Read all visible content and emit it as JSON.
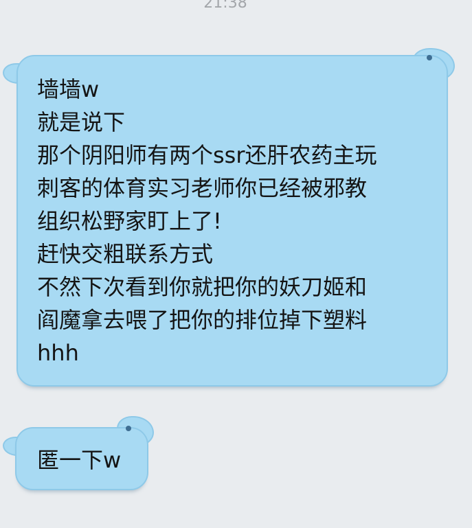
{
  "status": {
    "time": "21:38"
  },
  "messages": [
    {
      "lines": [
        "墙墙w",
        "就是说下",
        "那个阴阳师有两个ssr还肝农药主玩",
        "刺客的体育实习老师你已经被邪教",
        "组织松野家盯上了!",
        "赶快交粗联系方式",
        "不然下次看到你就把你的妖刀姬和",
        "阎魔拿去喂了把你的排位掉下塑料",
        "hhh"
      ]
    },
    {
      "lines": [
        "匿一下w"
      ]
    }
  ],
  "colors": {
    "background": "#e9ecef",
    "bubble_fill": "#a8daf3",
    "bubble_border": "#8ec9e8",
    "text": "#141414",
    "timestamp": "#a3a6aa"
  },
  "icons": {
    "bubble_decoration": "creature-ear-icon"
  }
}
